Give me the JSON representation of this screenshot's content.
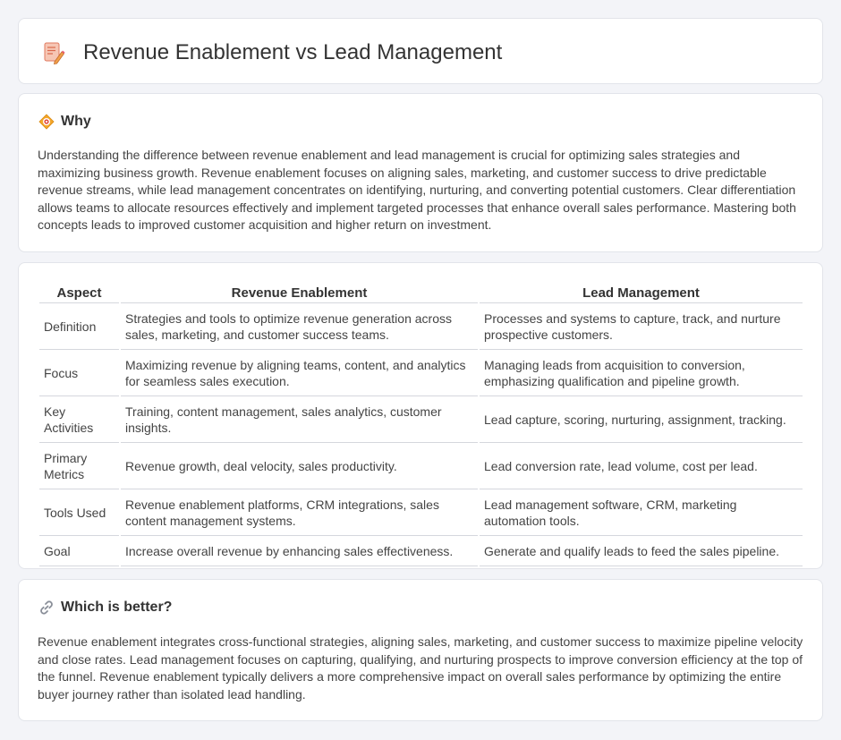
{
  "page": {
    "title": "Revenue Enablement vs Lead Management"
  },
  "why": {
    "title": "Why",
    "icon": "bullseye-diamond-icon",
    "text": "Understanding the difference between revenue enablement and lead management is crucial for optimizing sales strategies and maximizing business growth. Revenue enablement focuses on aligning sales, marketing, and customer success to drive predictable revenue streams, while lead management concentrates on identifying, nurturing, and converting potential customers. Clear differentiation allows teams to allocate resources effectively and implement targeted processes that enhance overall sales performance. Mastering both concepts leads to improved customer acquisition and higher return on investment."
  },
  "table": {
    "headers": [
      "Aspect",
      "Revenue Enablement",
      "Lead Management"
    ],
    "rows": [
      {
        "aspect": "Definition",
        "rev": "Strategies and tools to optimize revenue generation across sales, marketing, and customer success teams.",
        "lead": "Processes and systems to capture, track, and nurture prospective customers."
      },
      {
        "aspect": "Focus",
        "rev": "Maximizing revenue by aligning teams, content, and analytics for seamless sales execution.",
        "lead": "Managing leads from acquisition to conversion, emphasizing qualification and pipeline growth."
      },
      {
        "aspect": "Key Activities",
        "rev": "Training, content management, sales analytics, customer insights.",
        "lead": "Lead capture, scoring, nurturing, assignment, tracking."
      },
      {
        "aspect": "Primary Metrics",
        "rev": "Revenue growth, deal velocity, sales productivity.",
        "lead": "Lead conversion rate, lead volume, cost per lead."
      },
      {
        "aspect": "Tools Used",
        "rev": "Revenue enablement platforms, CRM integrations, sales content management systems.",
        "lead": "Lead management software, CRM, marketing automation tools."
      },
      {
        "aspect": "Goal",
        "rev": "Increase overall revenue by enhancing sales effectiveness.",
        "lead": "Generate and qualify leads to feed the sales pipeline."
      }
    ]
  },
  "better": {
    "title": "Which is better?",
    "icon": "link-icon",
    "text": "Revenue enablement integrates cross-functional strategies, aligning sales, marketing, and customer success to maximize pipeline velocity and close rates. Lead management focuses on capturing, qualifying, and nurturing prospects to improve conversion efficiency at the top of the funnel. Revenue enablement typically delivers a more comprehensive impact on overall sales performance by optimizing the entire buyer journey rather than isolated lead handling."
  }
}
